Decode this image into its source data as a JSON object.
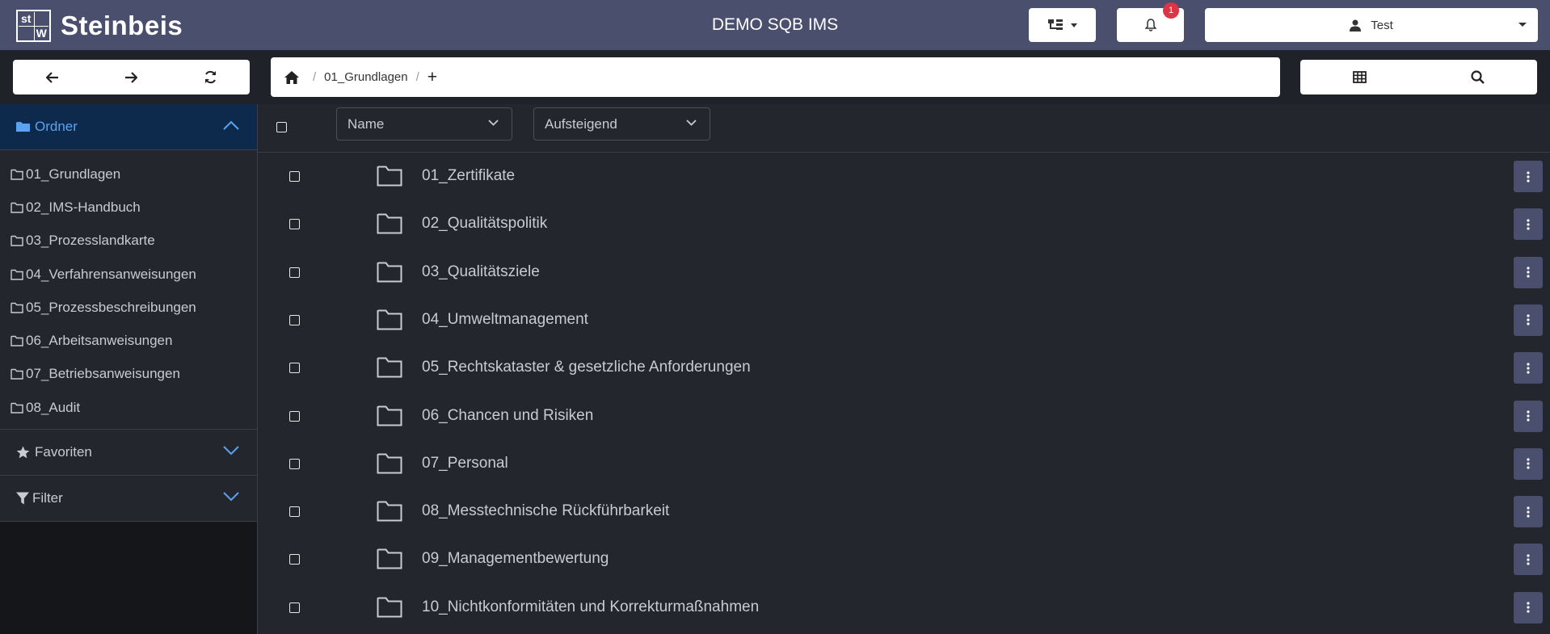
{
  "header": {
    "logo_top_left": "st",
    "logo_top_right": "",
    "logo_bottom_left": "",
    "logo_bottom_right": "W",
    "logo_text": "Steinbeis",
    "app_title": "DEMO SQB IMS",
    "notification_count": "1",
    "user_name": "Test"
  },
  "breadcrumb": {
    "current": "01_Grundlagen",
    "separator": "/",
    "add": "+"
  },
  "sidebar": {
    "folders_label": "Ordner",
    "folders": [
      "01_Grundlagen",
      "02_IMS-Handbuch",
      "03_Prozesslandkarte",
      "04_Verfahrensanweisungen",
      "05_Prozessbeschreibungen",
      "06_Arbeitsanweisungen",
      "07_Betriebsanweisungen",
      "08_Audit"
    ],
    "favorites_label": "Favoriten",
    "filter_label": "Filter"
  },
  "main": {
    "sort_field": "Name",
    "sort_order": "Aufsteigend",
    "rows": [
      "01_Zertifikate",
      "02_Qualitätspolitik",
      "03_Qualitätsziele",
      "04_Umweltmanagement",
      "05_Rechtskataster & gesetzliche Anforderungen",
      "06_Chancen und Risiken",
      "07_Personal",
      "08_Messtechnische Rückführbarkeit",
      "09_Managementbewertung",
      "10_Nichtkonformitäten und Korrekturmaßnahmen"
    ]
  },
  "colors": {
    "header_bg": "#4a4f6d",
    "accent": "#5aa3f0",
    "badge": "#dc3545"
  }
}
